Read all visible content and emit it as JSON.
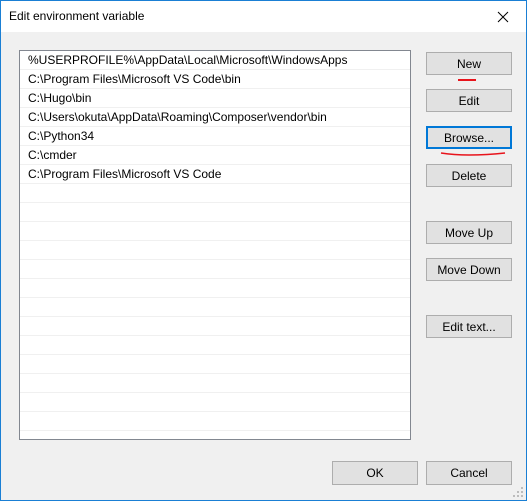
{
  "window": {
    "title": "Edit environment variable",
    "close_icon": "close-icon"
  },
  "list": {
    "items": [
      "%USERPROFILE%\\AppData\\Local\\Microsoft\\WindowsApps",
      "C:\\Program Files\\Microsoft VS Code\\bin",
      "C:\\Hugo\\bin",
      "C:\\Users\\okuta\\AppData\\Roaming\\Composer\\vendor\\bin",
      "C:\\Python34",
      "C:\\cmder",
      "C:\\Program Files\\Microsoft VS Code",
      "",
      "",
      "",
      "",
      "",
      "",
      "",
      "",
      "",
      "",
      "",
      "",
      "",
      ""
    ]
  },
  "buttons": {
    "new": "New",
    "edit": "Edit",
    "browse": "Browse...",
    "delete": "Delete",
    "move_up": "Move Up",
    "move_down": "Move Down",
    "edit_text": "Edit text...",
    "ok": "OK",
    "cancel": "Cancel"
  },
  "annotations": {
    "color": "#e8141c",
    "marks": [
      "new-underline",
      "browse-underline"
    ]
  },
  "focused_button": "browse"
}
